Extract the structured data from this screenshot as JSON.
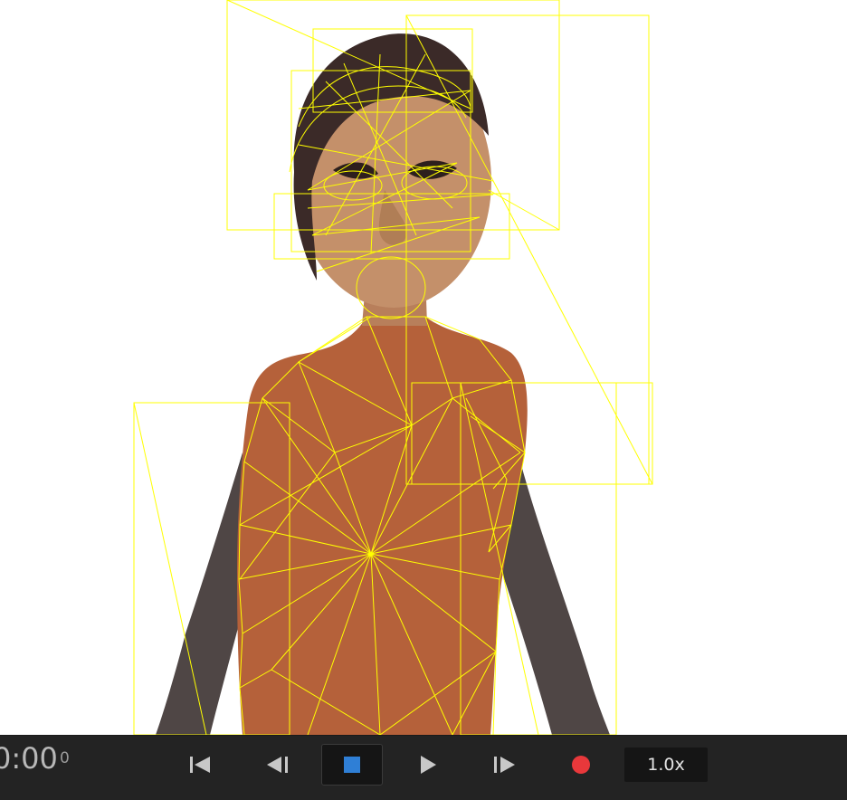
{
  "viewport": {
    "description_icon": "avatar-wireframe-overlay",
    "colors": {
      "background": "#ffffff",
      "wire": "#ffff00",
      "body": "#b5613a",
      "arms": "#4f4645",
      "skin": "#c4906a",
      "hair": "#3b2a28"
    }
  },
  "transport": {
    "timecode": "0:00",
    "frame": "0",
    "buttons": {
      "skip_start_icon": "skip-to-start-icon",
      "step_back_icon": "step-back-icon",
      "stop_icon": "stop-icon",
      "play_icon": "play-icon",
      "step_forward_icon": "step-forward-icon",
      "record_icon": "record-icon"
    },
    "speed": "1.0x",
    "colors": {
      "bar": "#232323",
      "icon": "#c8c8c8",
      "stop": "#2f7fd6",
      "record": "#e8383b"
    }
  }
}
